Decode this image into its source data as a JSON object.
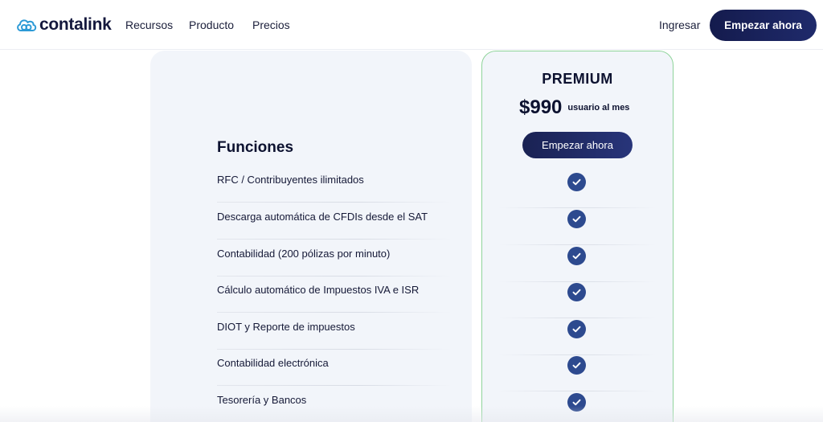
{
  "navbar": {
    "brand": "contalink",
    "links": [
      "Recursos",
      "Producto",
      "Precios"
    ],
    "login": "Ingresar",
    "cta": "Empezar ahora"
  },
  "features": {
    "title": "Funciones",
    "items": [
      "RFC / Contribuyentes ilimitados",
      "Descarga automática de CFDIs desde el SAT",
      "Contabilidad (200 pólizas por minuto)",
      "Cálculo automático de Impuestos IVA e ISR",
      "DIOT y Reporte de impuestos",
      "Contabilidad electrónica",
      "Tesorería y Bancos"
    ]
  },
  "plan": {
    "name": "PREMIUM",
    "price": "$990",
    "price_unit": "usuario al mes",
    "cta": "Empezar ahora",
    "included": [
      true,
      true,
      true,
      true,
      true,
      true,
      true
    ]
  },
  "colors": {
    "brand_navy": "#141b4d",
    "check_blue": "#2d4a8f",
    "premium_border": "#8fd49a",
    "card_bg": "#f2f5fa"
  },
  "icons": {
    "logo": "cloud-link-icon",
    "included": "check-circle-icon"
  }
}
